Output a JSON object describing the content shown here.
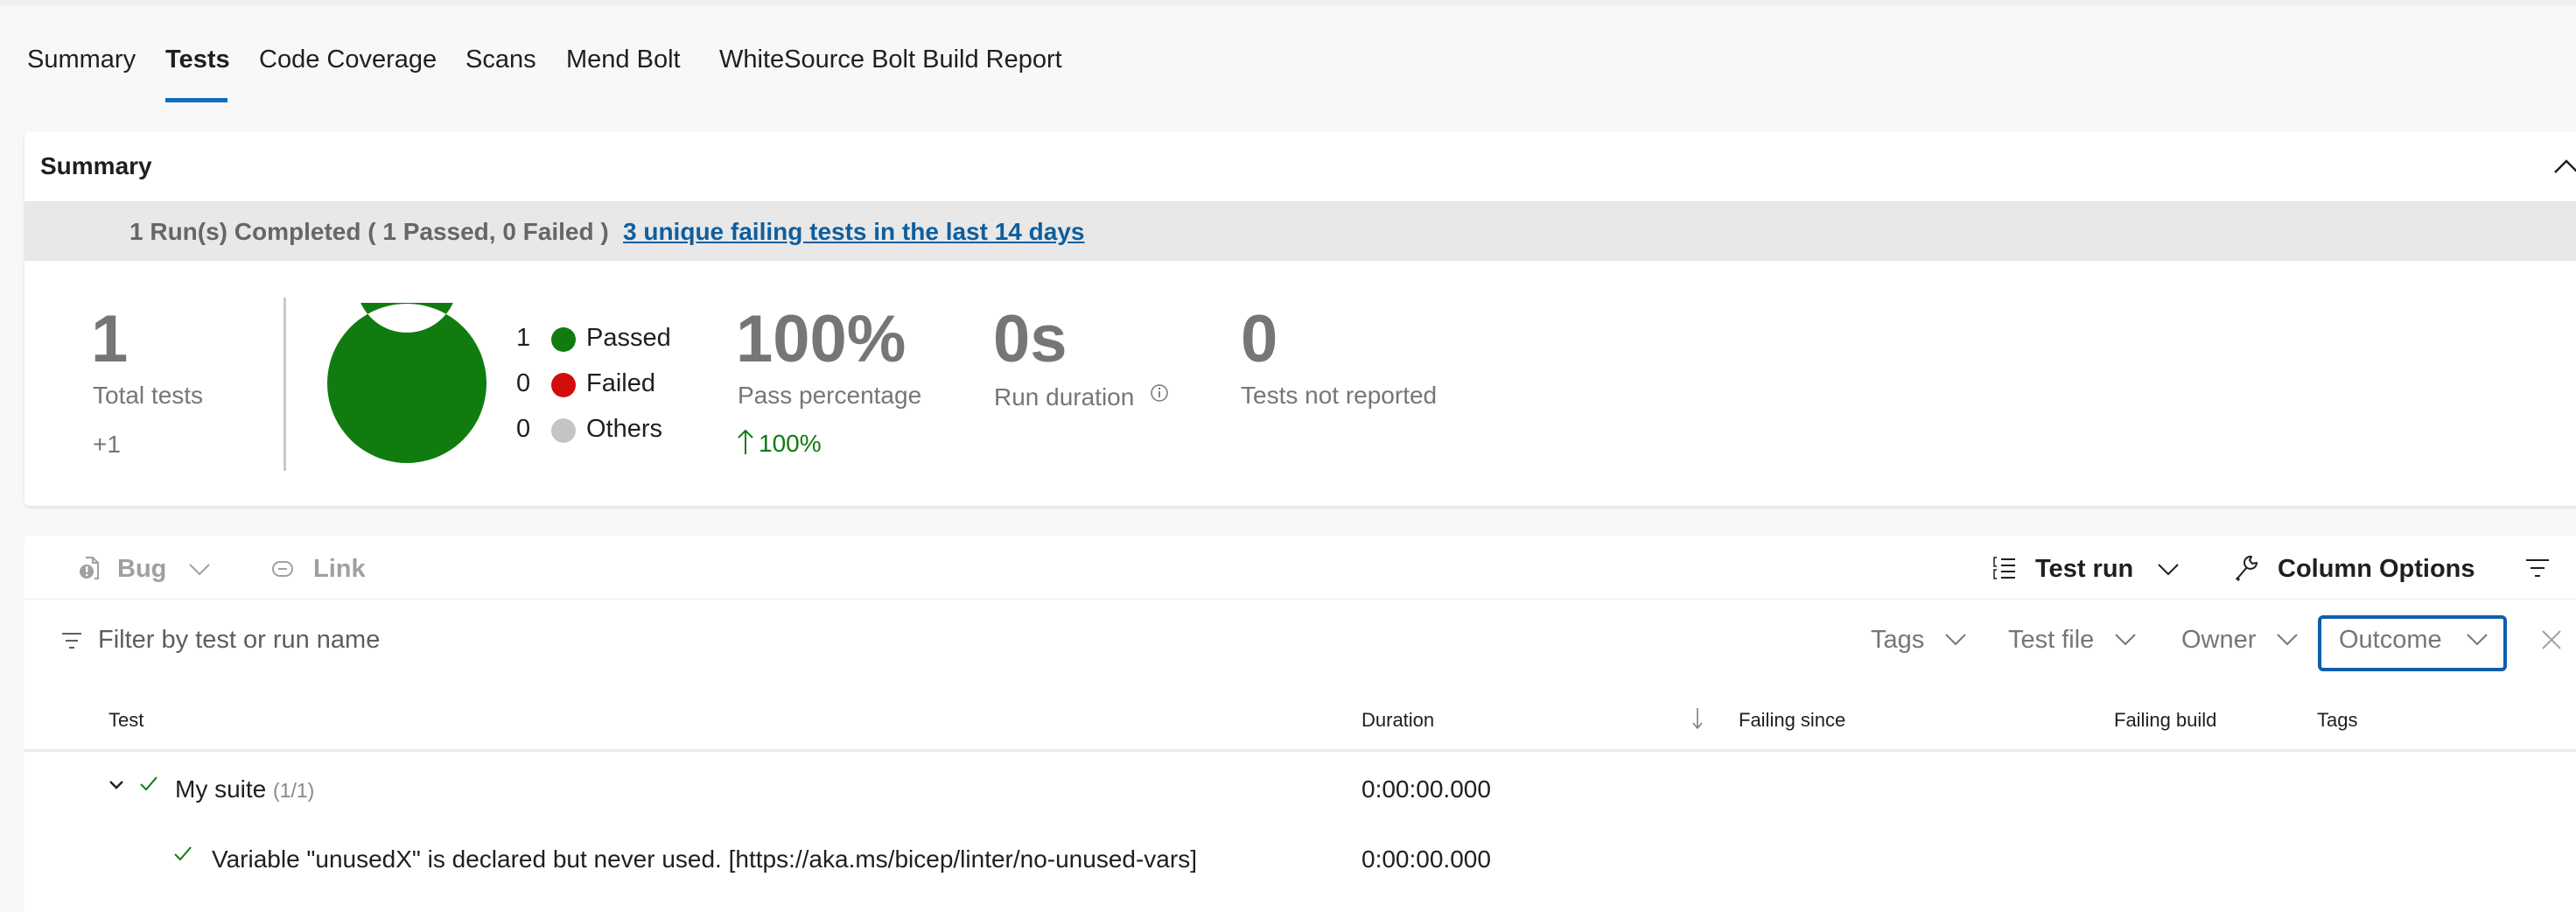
{
  "tabs": [
    {
      "label": "Summary",
      "active": false
    },
    {
      "label": "Tests",
      "active": true
    },
    {
      "label": "Code Coverage",
      "active": false
    },
    {
      "label": "Scans",
      "active": false
    },
    {
      "label": "Mend Bolt",
      "active": false
    },
    {
      "label": "WhiteSource Bolt Build Report",
      "active": false
    }
  ],
  "summary": {
    "title": "Summary",
    "run_status": "1 Run(s) Completed ( 1 Passed, 0 Failed )",
    "failing_link": "3 unique failing tests in the last 14 days",
    "total_tests": {
      "value": "1",
      "label": "Total tests",
      "delta": "+1"
    },
    "outcomes": [
      {
        "count": "1",
        "label": "Passed",
        "color": "#107c10"
      },
      {
        "count": "0",
        "label": "Failed",
        "color": "#d50c0c"
      },
      {
        "count": "0",
        "label": "Others",
        "color": "#c4c4c4"
      }
    ],
    "pass_percentage": {
      "value": "100%",
      "label": "Pass percentage",
      "trend": "100%"
    },
    "run_duration": {
      "value": "0s",
      "label": "Run duration"
    },
    "tests_not_reported": {
      "value": "0",
      "label": "Tests not reported"
    }
  },
  "chart_data": {
    "type": "pie",
    "title": "",
    "categories": [
      "Passed",
      "Failed",
      "Others"
    ],
    "values": [
      1,
      0,
      0
    ],
    "colors": [
      "#107c10",
      "#d50c0c",
      "#c4c4c4"
    ],
    "donut": true,
    "legend": "right"
  },
  "toolbar": {
    "bug_label": "Bug",
    "link_label": "Link",
    "test_run_label": "Test run",
    "column_options_label": "Column Options"
  },
  "filter": {
    "placeholder": "Filter by test or run name",
    "value": "",
    "dropdowns": [
      "Tags",
      "Test file",
      "Owner",
      "Outcome"
    ],
    "selected_dropdown": "Outcome"
  },
  "table": {
    "columns": [
      "Test",
      "Duration",
      "Failing since",
      "Failing build",
      "Tags"
    ],
    "sort_column": "Duration",
    "rows": [
      {
        "type": "suite",
        "name": "My suite",
        "count": "(1/1)",
        "duration": "0:00:00.000",
        "failing_since": "",
        "failing_build": "",
        "tags": "",
        "outcome": "passed"
      },
      {
        "type": "test",
        "name": "Variable \"unusedX\" is declared but never used. [https://aka.ms/bicep/linter/no-unused-vars]",
        "duration": "0:00:00.000",
        "failing_since": "",
        "failing_build": "",
        "tags": "",
        "outcome": "passed"
      }
    ]
  }
}
